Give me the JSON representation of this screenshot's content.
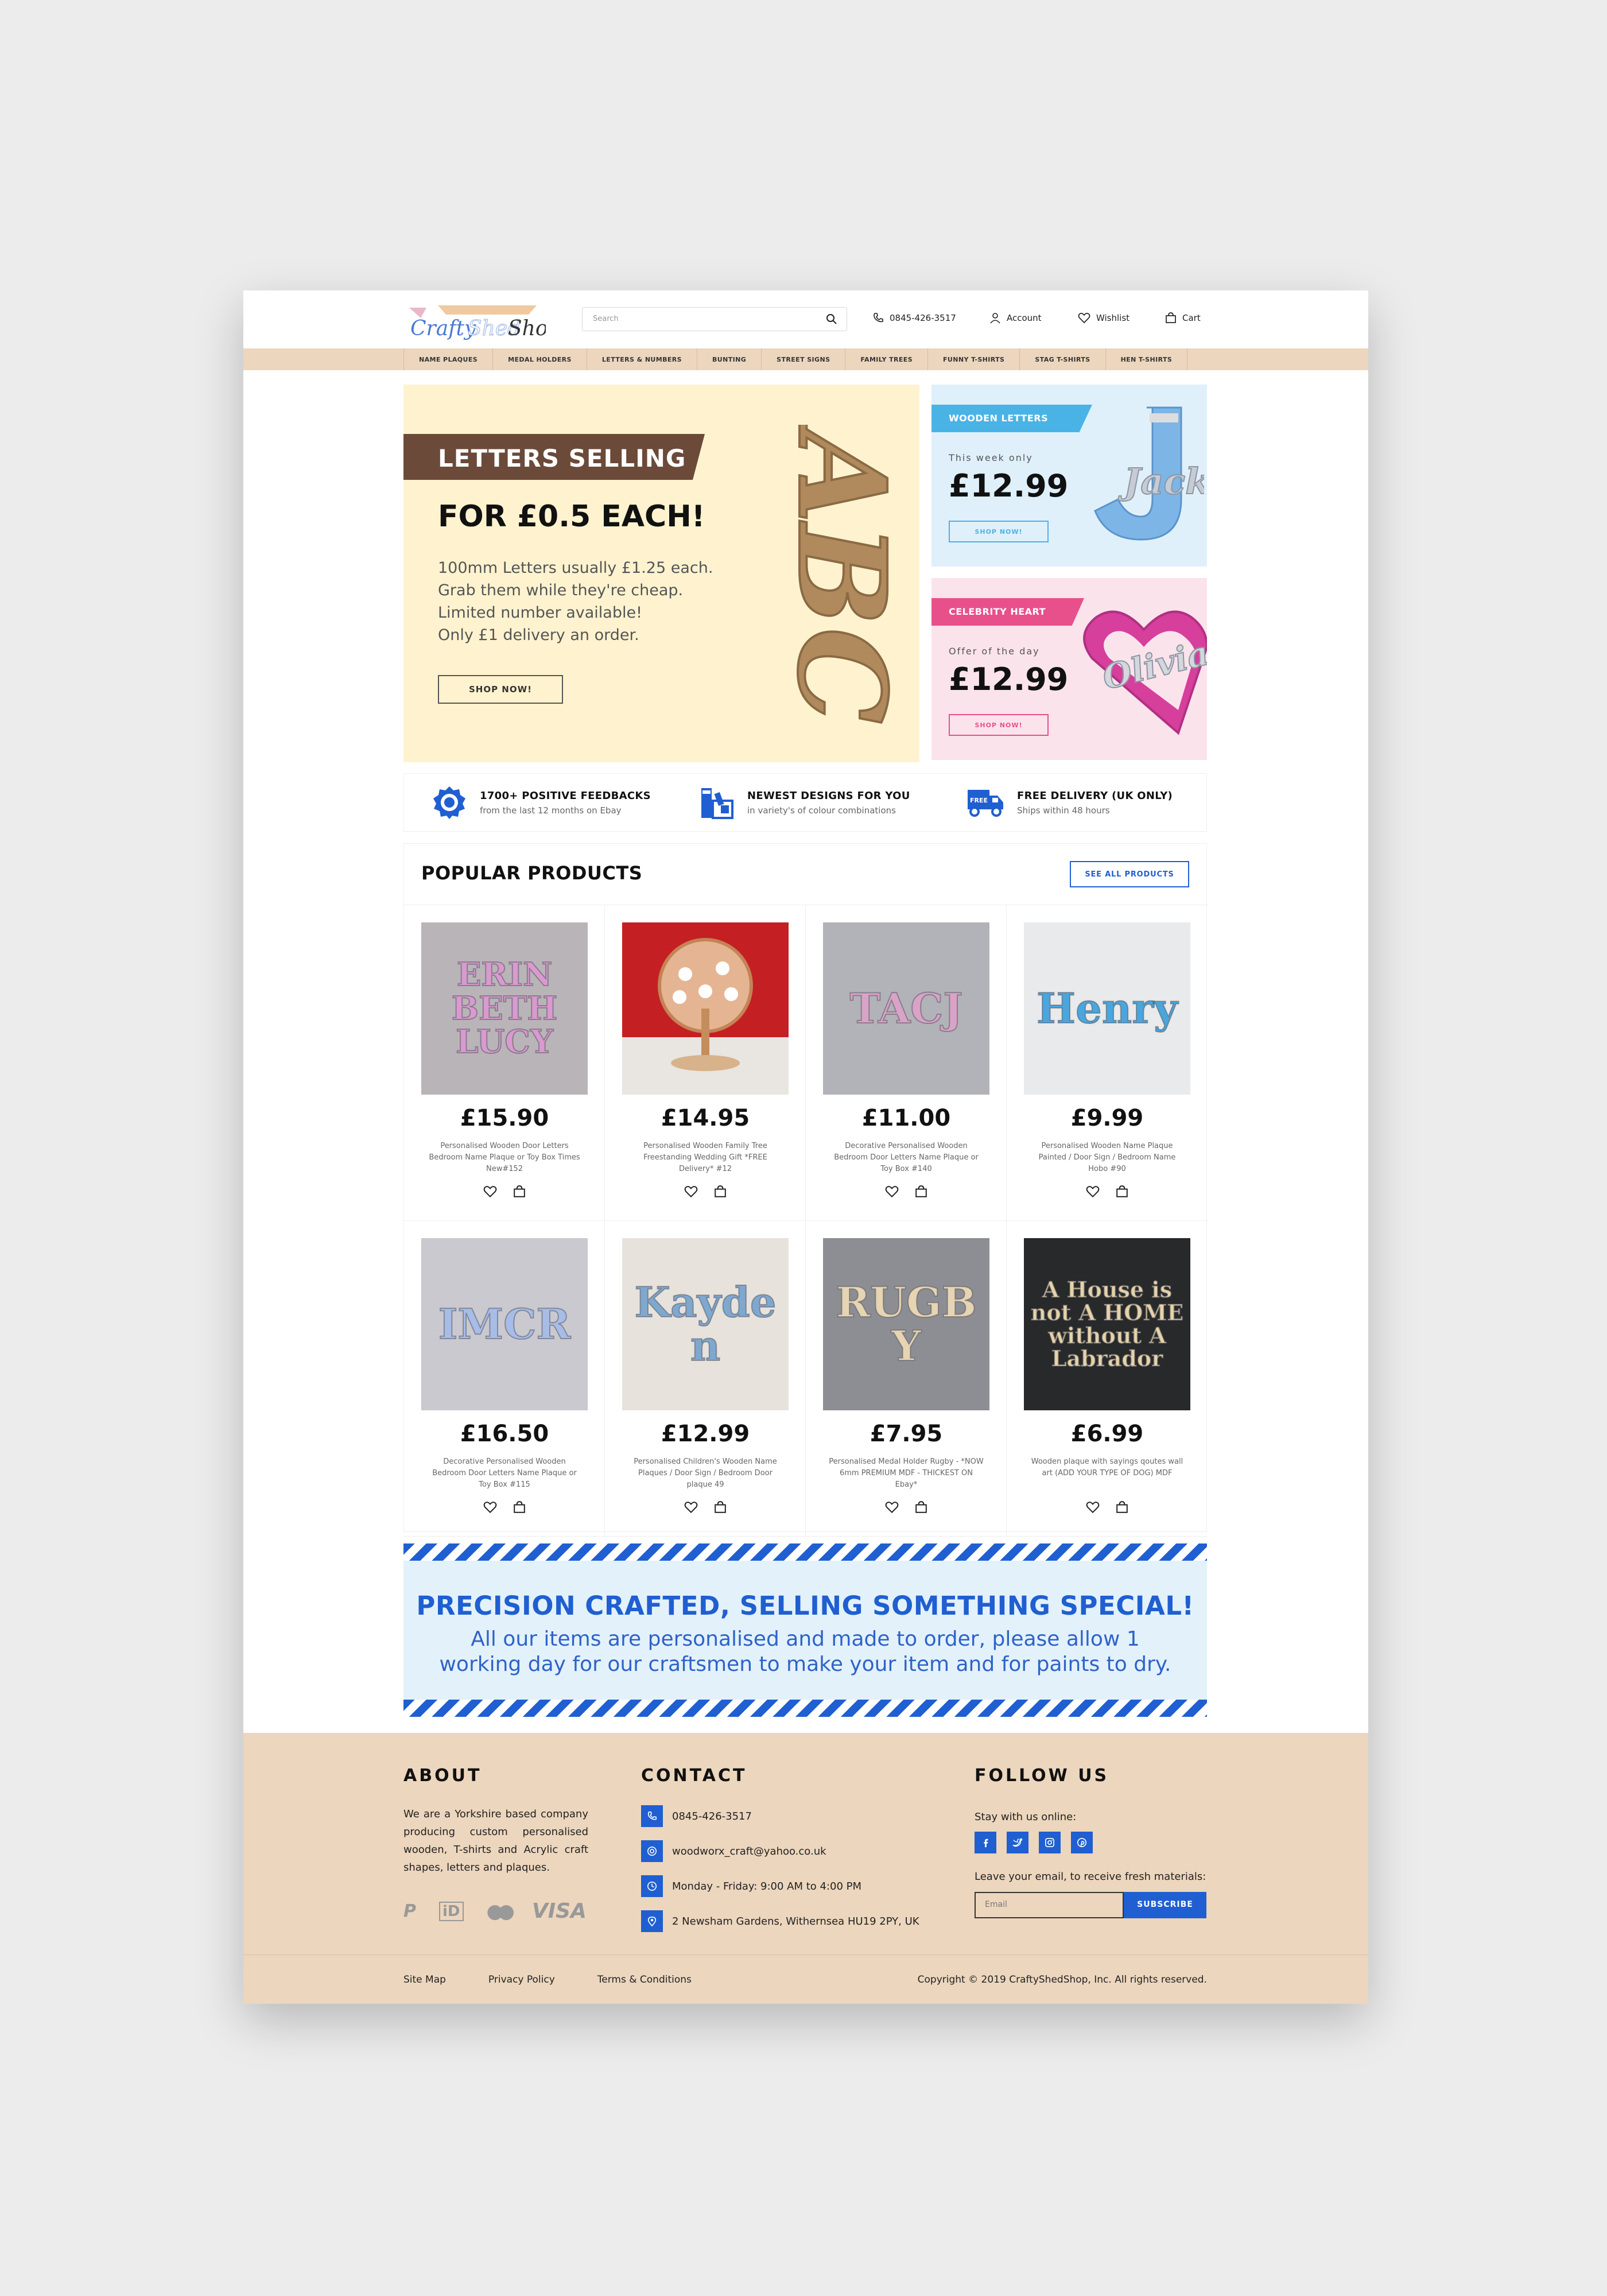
{
  "header": {
    "logo_text": "CraftyShedShop",
    "search_placeholder": "Search",
    "phone": "0845-426-3517",
    "account": "Account",
    "wishlist": "Wishlist",
    "cart": "Cart"
  },
  "nav": [
    "NAME PLAQUES",
    "MEDAL HOLDERS",
    "LETTERS & NUMBERS",
    "BUNTING",
    "STREET SIGNS",
    "FAMILY TREES",
    "FUNNY T-SHIRTS",
    "STAG T-SHIRTS",
    "HEN T-SHIRTS"
  ],
  "hero": {
    "ribbon": "LETTERS SELLING",
    "headline": "FOR £0.5 EACH!",
    "lines": [
      "100mm Letters usually £1.25 each.",
      "Grab them while they're cheap.",
      "Limited number available!",
      "Only £1 delivery an order."
    ],
    "button": "SHOP NOW!",
    "image_text": "ABC"
  },
  "promos": [
    {
      "tag": "WOODEN LETTERS",
      "sub": "This week only",
      "price": "£12.99",
      "button": "SHOP NOW!",
      "color": "#4ab3e6",
      "bg": "#dff0fb",
      "image_text": "Jack"
    },
    {
      "tag": "CELEBRITY HEART",
      "sub": "Offer of the day",
      "price": "£12.99",
      "button": "SHOP NOW!",
      "color": "#e8508b",
      "bg": "#fbe3ec",
      "image_text": "Olivia"
    }
  ],
  "features": [
    {
      "title": "1700+ POSITIVE FEEDBACKS",
      "sub": "from the last 12 months on Ebay",
      "icon": "badge-icon"
    },
    {
      "title": "NEWEST DESIGNS FOR YOU",
      "sub": "in variety's of colour combinations",
      "icon": "paint-icon"
    },
    {
      "title": "FREE DELIVERY (UK ONLY)",
      "sub": "Ships within 48 hours",
      "icon": "truck-icon"
    }
  ],
  "popular": {
    "title": "POPULAR PRODUCTS",
    "see_all": "SEE ALL PRODUCTS",
    "products": [
      {
        "price": "£15.90",
        "name": "Personalised Wooden Door Letters Bedroom Name Plaque or Toy Box Times New#152",
        "image_text": "ERIN BETH LUCY",
        "img_bg": "#b9b4b8",
        "img_fg": "#d99ad0"
      },
      {
        "price": "£14.95",
        "name": "Personalised Wooden Family Tree Freestanding Wedding Gift *FREE Delivery* #12",
        "image_text": "",
        "img_bg": "#c41f23",
        "img_fg": "#e9c6a0"
      },
      {
        "price": "£11.00",
        "name": "Decorative Personalised Wooden Bedroom Door Letters Name Plaque or Toy Box #140",
        "image_text": "TACJ",
        "img_bg": "#b2b3b8",
        "img_fg": "#d9a3c8"
      },
      {
        "price": "£9.99",
        "name": "Personalised Wooden Name Plaque Painted / Door Sign / Bedroom Name Hobo #90",
        "image_text": "Henry",
        "img_bg": "#e9eaec",
        "img_fg": "#4aa6dd"
      },
      {
        "price": "£16.50",
        "name": "Decorative Personalised Wooden Bedroom Door Letters Name Plaque or Toy Box #115",
        "image_text": "IMCR",
        "img_bg": "#c9c9cf",
        "img_fg": "#a7bde8"
      },
      {
        "price": "£12.99",
        "name": "Personalised Children's Wooden Name Plaques / Door Sign / Bedroom Door plaque 49",
        "image_text": "Kayden",
        "img_bg": "#e8e2dc",
        "img_fg": "#7fa8cf"
      },
      {
        "price": "£7.95",
        "name": "Personalised Medal Holder Rugby - *NOW 6mm PREMIUM MDF - THICKEST ON Ebay*",
        "image_text": "RUGBY",
        "img_bg": "#8c8e93",
        "img_fg": "#e7d4b3"
      },
      {
        "price": "£6.99",
        "name": "Wooden plaque with sayings qoutes wall art (ADD YOUR TYPE OF DOG) MDF",
        "image_text": "A House is not A HOME without A Labrador",
        "img_bg": "#27292a",
        "img_fg": "#e6d3a8"
      }
    ]
  },
  "banner": {
    "title": "PRECISION CRAFTED, SELLING SOMETHING SPECIAL!",
    "text": "All our items are personalised and made to order, please allow 1 working day for our craftsmen to make your item and for paints to dry."
  },
  "footer": {
    "about_title": "ABOUT",
    "about_text": "We are a Yorkshire based company producing custom personalised wooden, T-shirts and Acrylic craft shapes, letters and plaques.",
    "payments": [
      "P",
      "iD",
      "●●",
      "VISA"
    ],
    "contact_title": "CONTACT",
    "contact": [
      "0845-426-3517",
      "woodworx_craft@yahoo.co.uk",
      "Monday - Friday: 9:00 AM to 4:00 PM",
      "2 Newsham Gardens, Withernsea HU19 2PY, UK"
    ],
    "follow_title": "FOLLOW US",
    "stay": "Stay with us online:",
    "leave": "Leave your email, to receive fresh materials:",
    "email_placeholder": "Email",
    "subscribe": "SUBSCRIBE",
    "links": [
      "Site Map",
      "Privacy Policy",
      "Terms & Conditions"
    ],
    "copyright": "Copyright © 2019 CraftyShedShop, Inc. All rights reserved."
  },
  "colors": {
    "accent": "#1f5fd1",
    "beige": "#ecd6bd",
    "hero_bg": "#fff3cf"
  }
}
